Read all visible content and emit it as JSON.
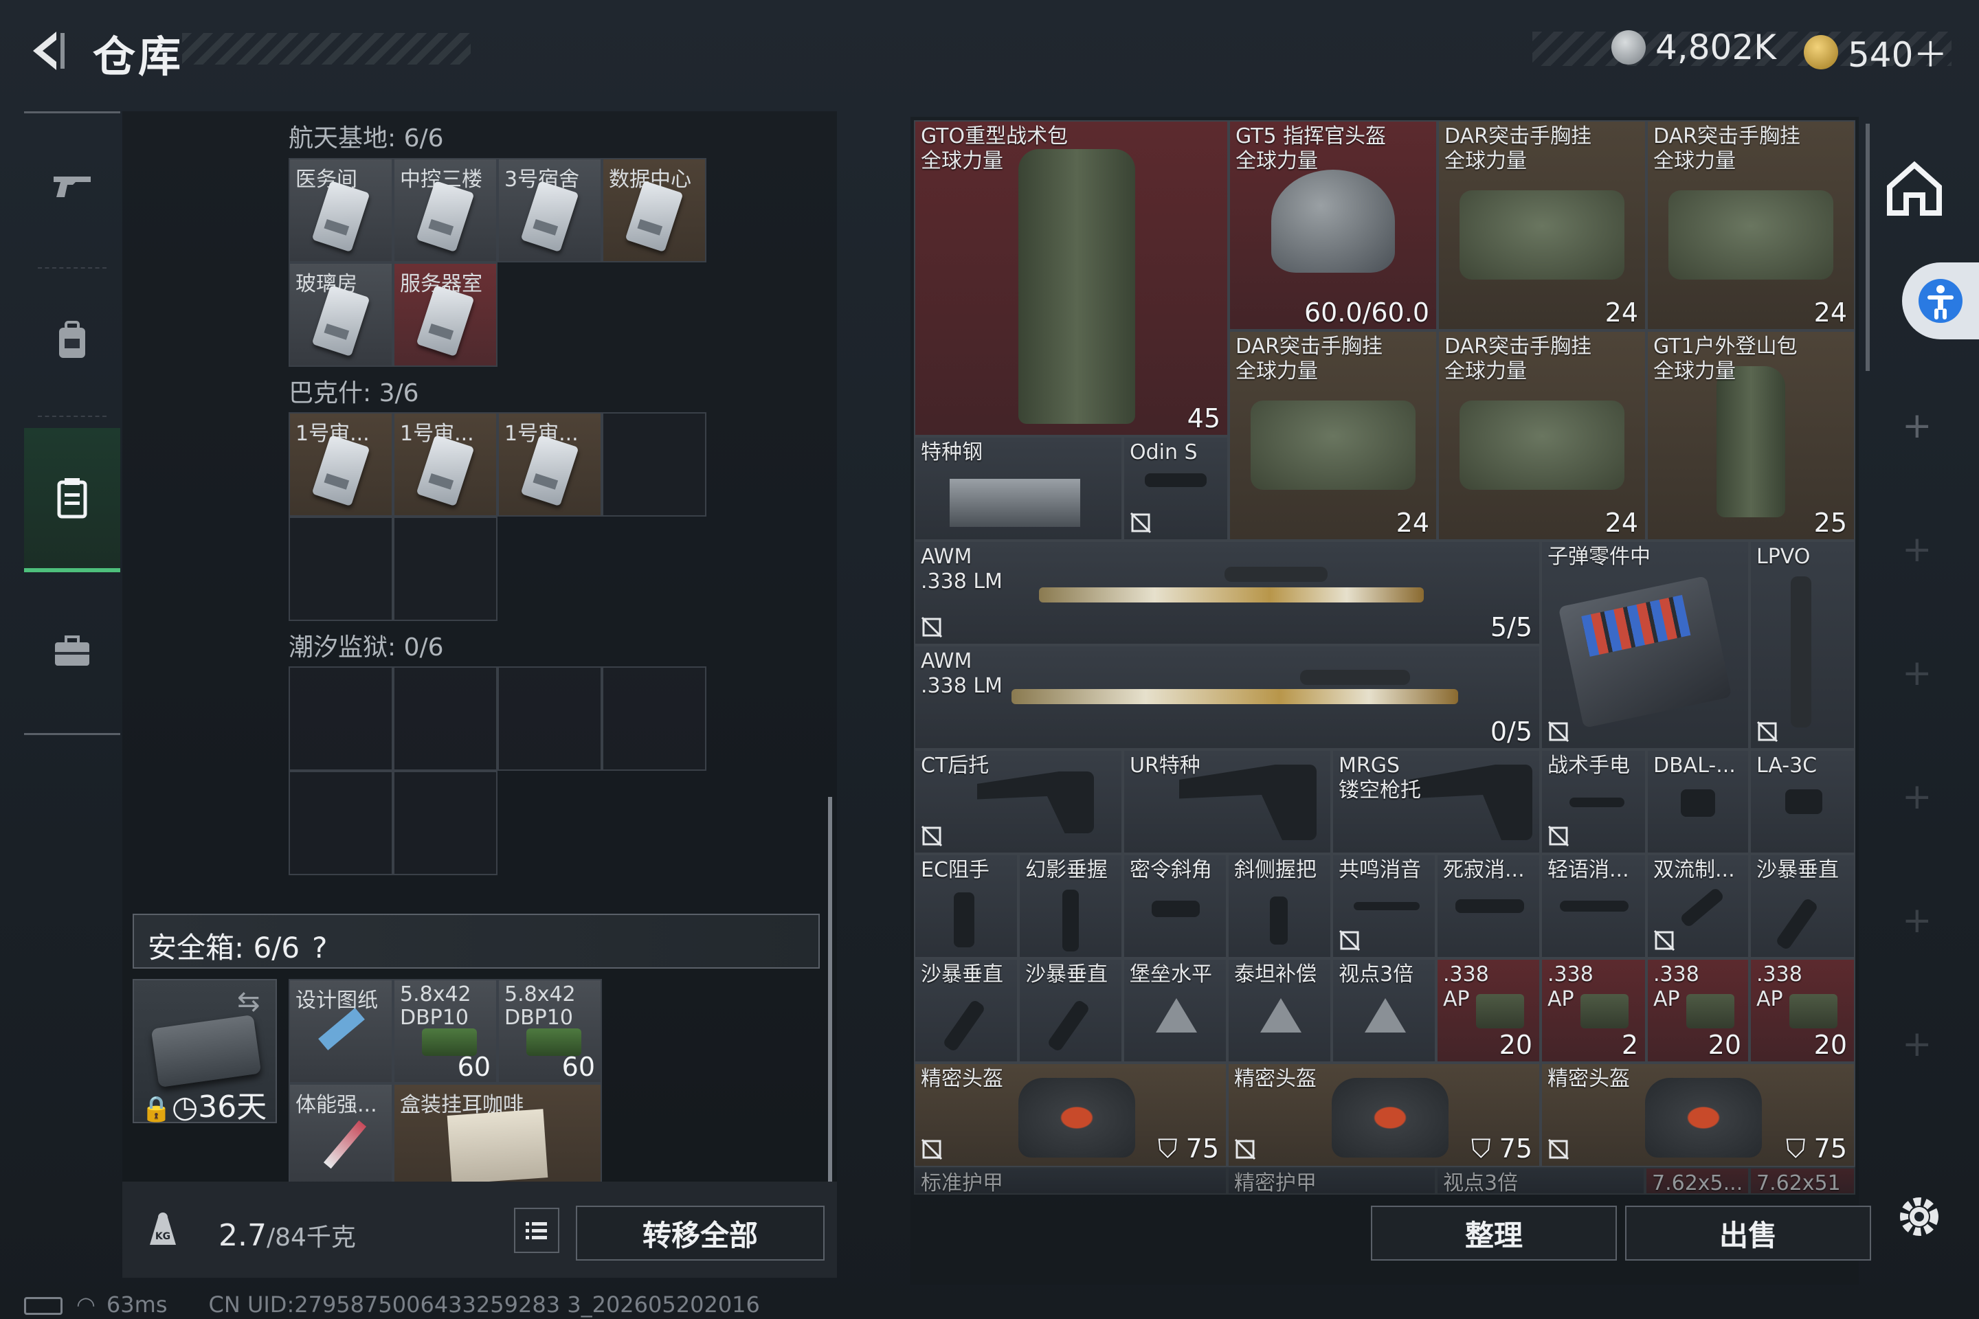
{
  "header": {
    "title": "仓库"
  },
  "currency": {
    "money": "4,802K",
    "coins": "540＋",
    "money_color": "#9aa0a6",
    "coin_color": "#d4a93a"
  },
  "nav": {
    "items": [
      {
        "icon": "gun-icon"
      },
      {
        "icon": "backpack-icon"
      },
      {
        "icon": "storage-icon",
        "active": true
      },
      {
        "icon": "briefcase-icon"
      }
    ]
  },
  "sections": [
    {
      "title": "航天基地: 6/6",
      "items": [
        "医务间",
        "中控三楼",
        "3号宿舍",
        "数据中心",
        "玻璃房",
        "服务器室"
      ]
    },
    {
      "title": "巴克什: 3/6",
      "items": [
        "1号审...",
        "1号审...",
        "1号审..."
      ]
    },
    {
      "title": "潮汐监狱: 0/6",
      "items": []
    }
  ],
  "safe_box": {
    "label": "安全箱:  6/6",
    "help": "?",
    "days": "36天",
    "items": [
      {
        "name": "设计图纸",
        "count": ""
      },
      {
        "name": "5.8x42\nDBP10",
        "count": "60"
      },
      {
        "name": "5.8x42\nDBP10",
        "count": "60"
      },
      {
        "name": "体能强...",
        "count": ""
      },
      {
        "name": "盒装挂耳咖啡",
        "count": ""
      }
    ]
  },
  "weight": {
    "current": "2.7",
    "max": "/84千克"
  },
  "buttons": {
    "transfer": "转移全部",
    "sort": "整理",
    "sell": "出售"
  },
  "inventory": [
    {
      "name": "GTO重型战术包\n全球力量",
      "count": "45"
    },
    {
      "name": "GT5 指挥官头盔\n全球力量",
      "count": "60.0/60.0"
    },
    {
      "name": "DAR突击手胸挂\n全球力量",
      "count": "24"
    },
    {
      "name": "DAR突击手胸挂\n全球力量",
      "count": "24"
    },
    {
      "name": "DAR突击手胸挂\n全球力量",
      "count": "24"
    },
    {
      "name": "DAR突击手胸挂\n全球力量",
      "count": "24"
    },
    {
      "name": "GT1户外登山包\n全球力量",
      "count": "25"
    },
    {
      "name": "特种钢",
      "count": ""
    },
    {
      "name": "Odin S",
      "count": ""
    },
    {
      "name": "AWM\n.338 LM",
      "count": "5/5"
    },
    {
      "name": "AWM\n.338 LM",
      "count": "0/5"
    },
    {
      "name": "子弹零件中",
      "count": ""
    },
    {
      "name": "LPVO",
      "count": ""
    },
    {
      "name": "CT后托",
      "count": ""
    },
    {
      "name": "UR特种",
      "count": ""
    },
    {
      "name": "MRGS\n镂空枪托",
      "count": ""
    },
    {
      "name": "战术手电",
      "count": ""
    },
    {
      "name": "DBAL-...",
      "count": ""
    },
    {
      "name": "LA-3C",
      "count": ""
    },
    {
      "name": "EC阻手",
      "count": ""
    },
    {
      "name": "幻影垂握",
      "count": ""
    },
    {
      "name": "密令斜角",
      "count": ""
    },
    {
      "name": "斜侧握把",
      "count": ""
    },
    {
      "name": "共鸣消音",
      "count": ""
    },
    {
      "name": "死寂消...",
      "count": ""
    },
    {
      "name": "轻语消...",
      "count": ""
    },
    {
      "name": "双流制...",
      "count": ""
    },
    {
      "name": "沙暴垂直",
      "count": ""
    },
    {
      "name": "沙暴垂直",
      "count": ""
    },
    {
      "name": "沙暴垂直",
      "count": ""
    },
    {
      "name": "堡垒水平",
      "count": ""
    },
    {
      "name": "泰坦补偿",
      "count": ""
    },
    {
      "name": "视点3倍",
      "count": ""
    },
    {
      "name": ".338\nAP",
      "count": "20"
    },
    {
      "name": ".338\nAP",
      "count": "2"
    },
    {
      "name": ".338\nAP",
      "count": "20"
    },
    {
      "name": ".338\nAP",
      "count": "20"
    },
    {
      "name": "精密头盔",
      "count": "75"
    },
    {
      "name": "精密头盔",
      "count": "75"
    },
    {
      "name": "精密头盔",
      "count": "75"
    },
    {
      "name": "标准护甲",
      "count": ""
    },
    {
      "name": "精密护甲",
      "count": ""
    },
    {
      "name": "视点3倍",
      "count": ""
    },
    {
      "name": "7.62x5...",
      "count": ""
    },
    {
      "name": "7.62x51",
      "count": ""
    }
  ],
  "status": {
    "ping": "63ms",
    "uid": "CN UID:2795875006433259283 3_202605202016"
  }
}
